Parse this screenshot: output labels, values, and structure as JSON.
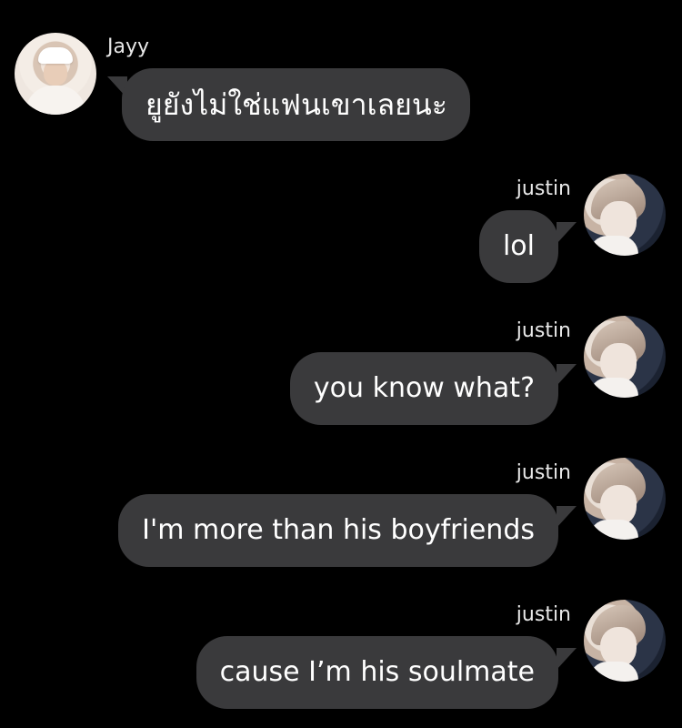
{
  "messages": [
    {
      "sender": "Jayy",
      "text": "ยูยังไม่ใช่แฟนเขาเลยนะ"
    },
    {
      "sender": "justin",
      "text": "lol"
    },
    {
      "sender": "justin",
      "text": "you know what?"
    },
    {
      "sender": "justin",
      "text": "I'm more than his boyfriends"
    },
    {
      "sender": "justin",
      "text": "cause I’m his soulmate"
    }
  ],
  "colors": {
    "background": "#000000",
    "bubble": "#3a3a3c",
    "text": "#ffffff"
  }
}
